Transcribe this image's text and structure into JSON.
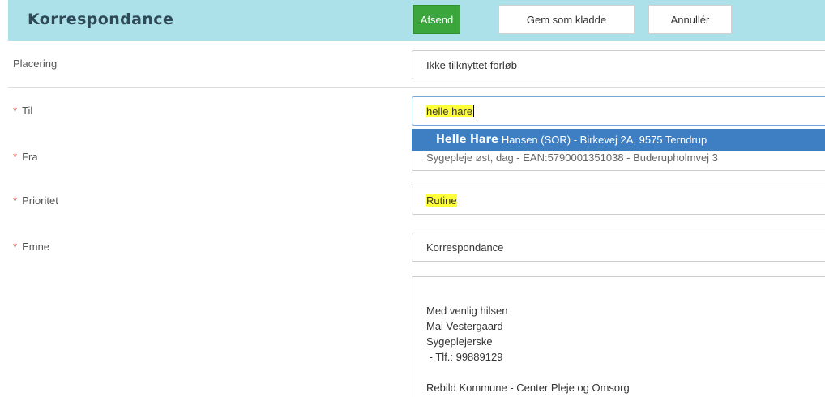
{
  "header": {
    "title": "Korrespondance",
    "buttons": {
      "send": "Afsend",
      "draft": "Gem som kladde",
      "cancel": "Annullér"
    }
  },
  "form": {
    "placering": {
      "label": "Placering",
      "value": "Ikke tilknyttet forløb"
    },
    "til": {
      "label": "Til",
      "value": "helle hare"
    },
    "fra": {
      "label": "Fra",
      "value": "Sygepleje øst, dag - EAN:5790001351038 - Buderupholmvej 3"
    },
    "prioritet": {
      "label": "Prioritet",
      "value": "Rutine"
    },
    "emne": {
      "label": "Emne",
      "value": "Korrespondance"
    },
    "required_marker": "*"
  },
  "suggestion": {
    "bold": "Helle Hare",
    "rest": "Hansen (SOR) - Birkevej 2A, 9575 Terndrup"
  },
  "message": {
    "lines": [
      "Med venlig hilsen",
      "Mai Vestergaard",
      "Sygeplejerske",
      " - Tlf.: 99889129"
    ],
    "footer": "Rebild Kommune - Center Pleje og Omsorg"
  },
  "colors": {
    "header_bg": "#ade1ea",
    "send_button": "#3aa63c",
    "highlight": "#ffff3a",
    "suggestion_bg": "#3d7fc2",
    "required": "#d9534f"
  }
}
